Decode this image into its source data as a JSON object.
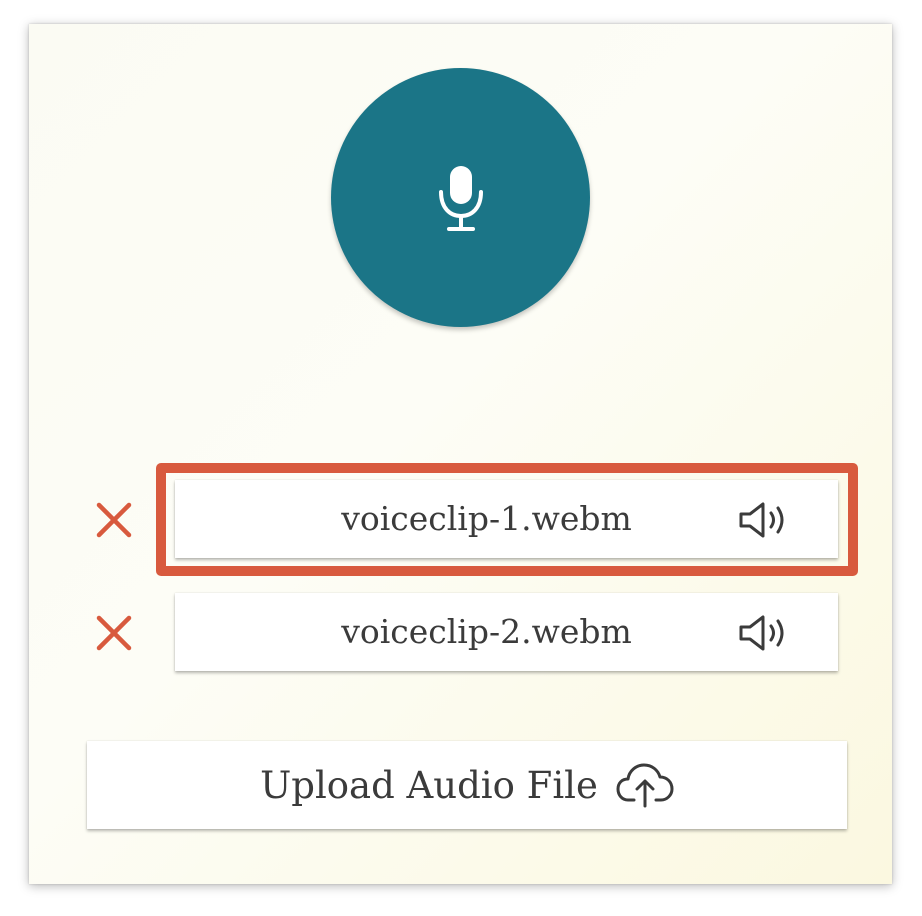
{
  "recorder": {
    "mic_icon": "microphone-icon",
    "color": "#1b7587"
  },
  "clips": [
    {
      "name": "voiceclip-1.webm",
      "remove_icon": "close-icon",
      "play_icon": "speaker-icon",
      "highlighted": true
    },
    {
      "name": "voiceclip-2.webm",
      "remove_icon": "close-icon",
      "play_icon": "speaker-icon",
      "highlighted": false
    }
  ],
  "upload": {
    "label": "Upload Audio File",
    "icon": "cloud-upload-icon"
  },
  "colors": {
    "accent": "#1b7587",
    "remove": "#d85a3e",
    "highlight_border": "#d85a3e",
    "text": "#3b3b3b"
  }
}
